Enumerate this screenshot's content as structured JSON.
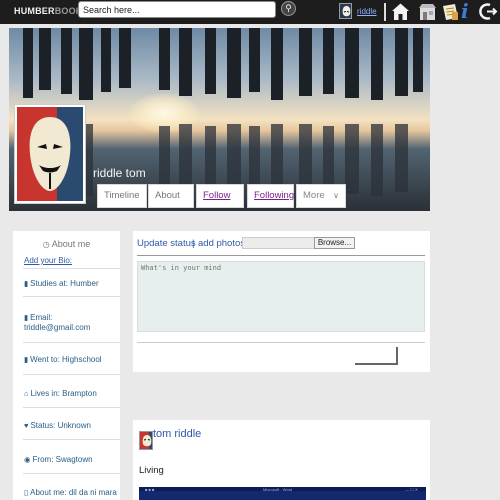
{
  "header": {
    "logo_part1": "HUMBER",
    "logo_part2": "BOOK",
    "search_placeholder": "Search here...",
    "username": "riddle",
    "icons": [
      "search-icon",
      "home-icon",
      "store-icon",
      "newspaper-icon",
      "info-icon",
      "logout-icon"
    ]
  },
  "cover": {
    "name": "riddle tom",
    "tabs": [
      {
        "label": "Timeline"
      },
      {
        "label": "About"
      },
      {
        "label": "Follow"
      },
      {
        "label": "Following"
      },
      {
        "label": "More"
      }
    ]
  },
  "about": {
    "title": "About me",
    "add_bio": "Add your Bio:",
    "items": [
      {
        "icon": "book-icon",
        "text": "Studies at: Humber"
      },
      {
        "icon": "book-icon",
        "text": "Email: triddle@gmail.com"
      },
      {
        "icon": "book-icon",
        "text": "Went to: Highschool"
      },
      {
        "icon": "home-icon",
        "text": "Lives in: Brampton"
      },
      {
        "icon": "heart-icon",
        "text": "Status: Unknown"
      },
      {
        "icon": "globe-icon",
        "text": "From: Swagtown"
      },
      {
        "icon": "phone-icon",
        "text": "About me: dil da ni mara"
      }
    ]
  },
  "status": {
    "update_status": "Update status",
    "separator": "|",
    "add_photos": "add photos",
    "browse_label": "Browse...",
    "placeholder": "What's in your mind"
  },
  "post": {
    "author": "tom riddle",
    "text": "Living",
    "image_caption": "Microsoft - Word"
  },
  "colors": {
    "topbar": "#1d1d1d",
    "link": "#2f5aa8",
    "visited_link": "#7a1f8f",
    "about_text": "#2a5e86",
    "status_bg": "#e6eeee"
  }
}
